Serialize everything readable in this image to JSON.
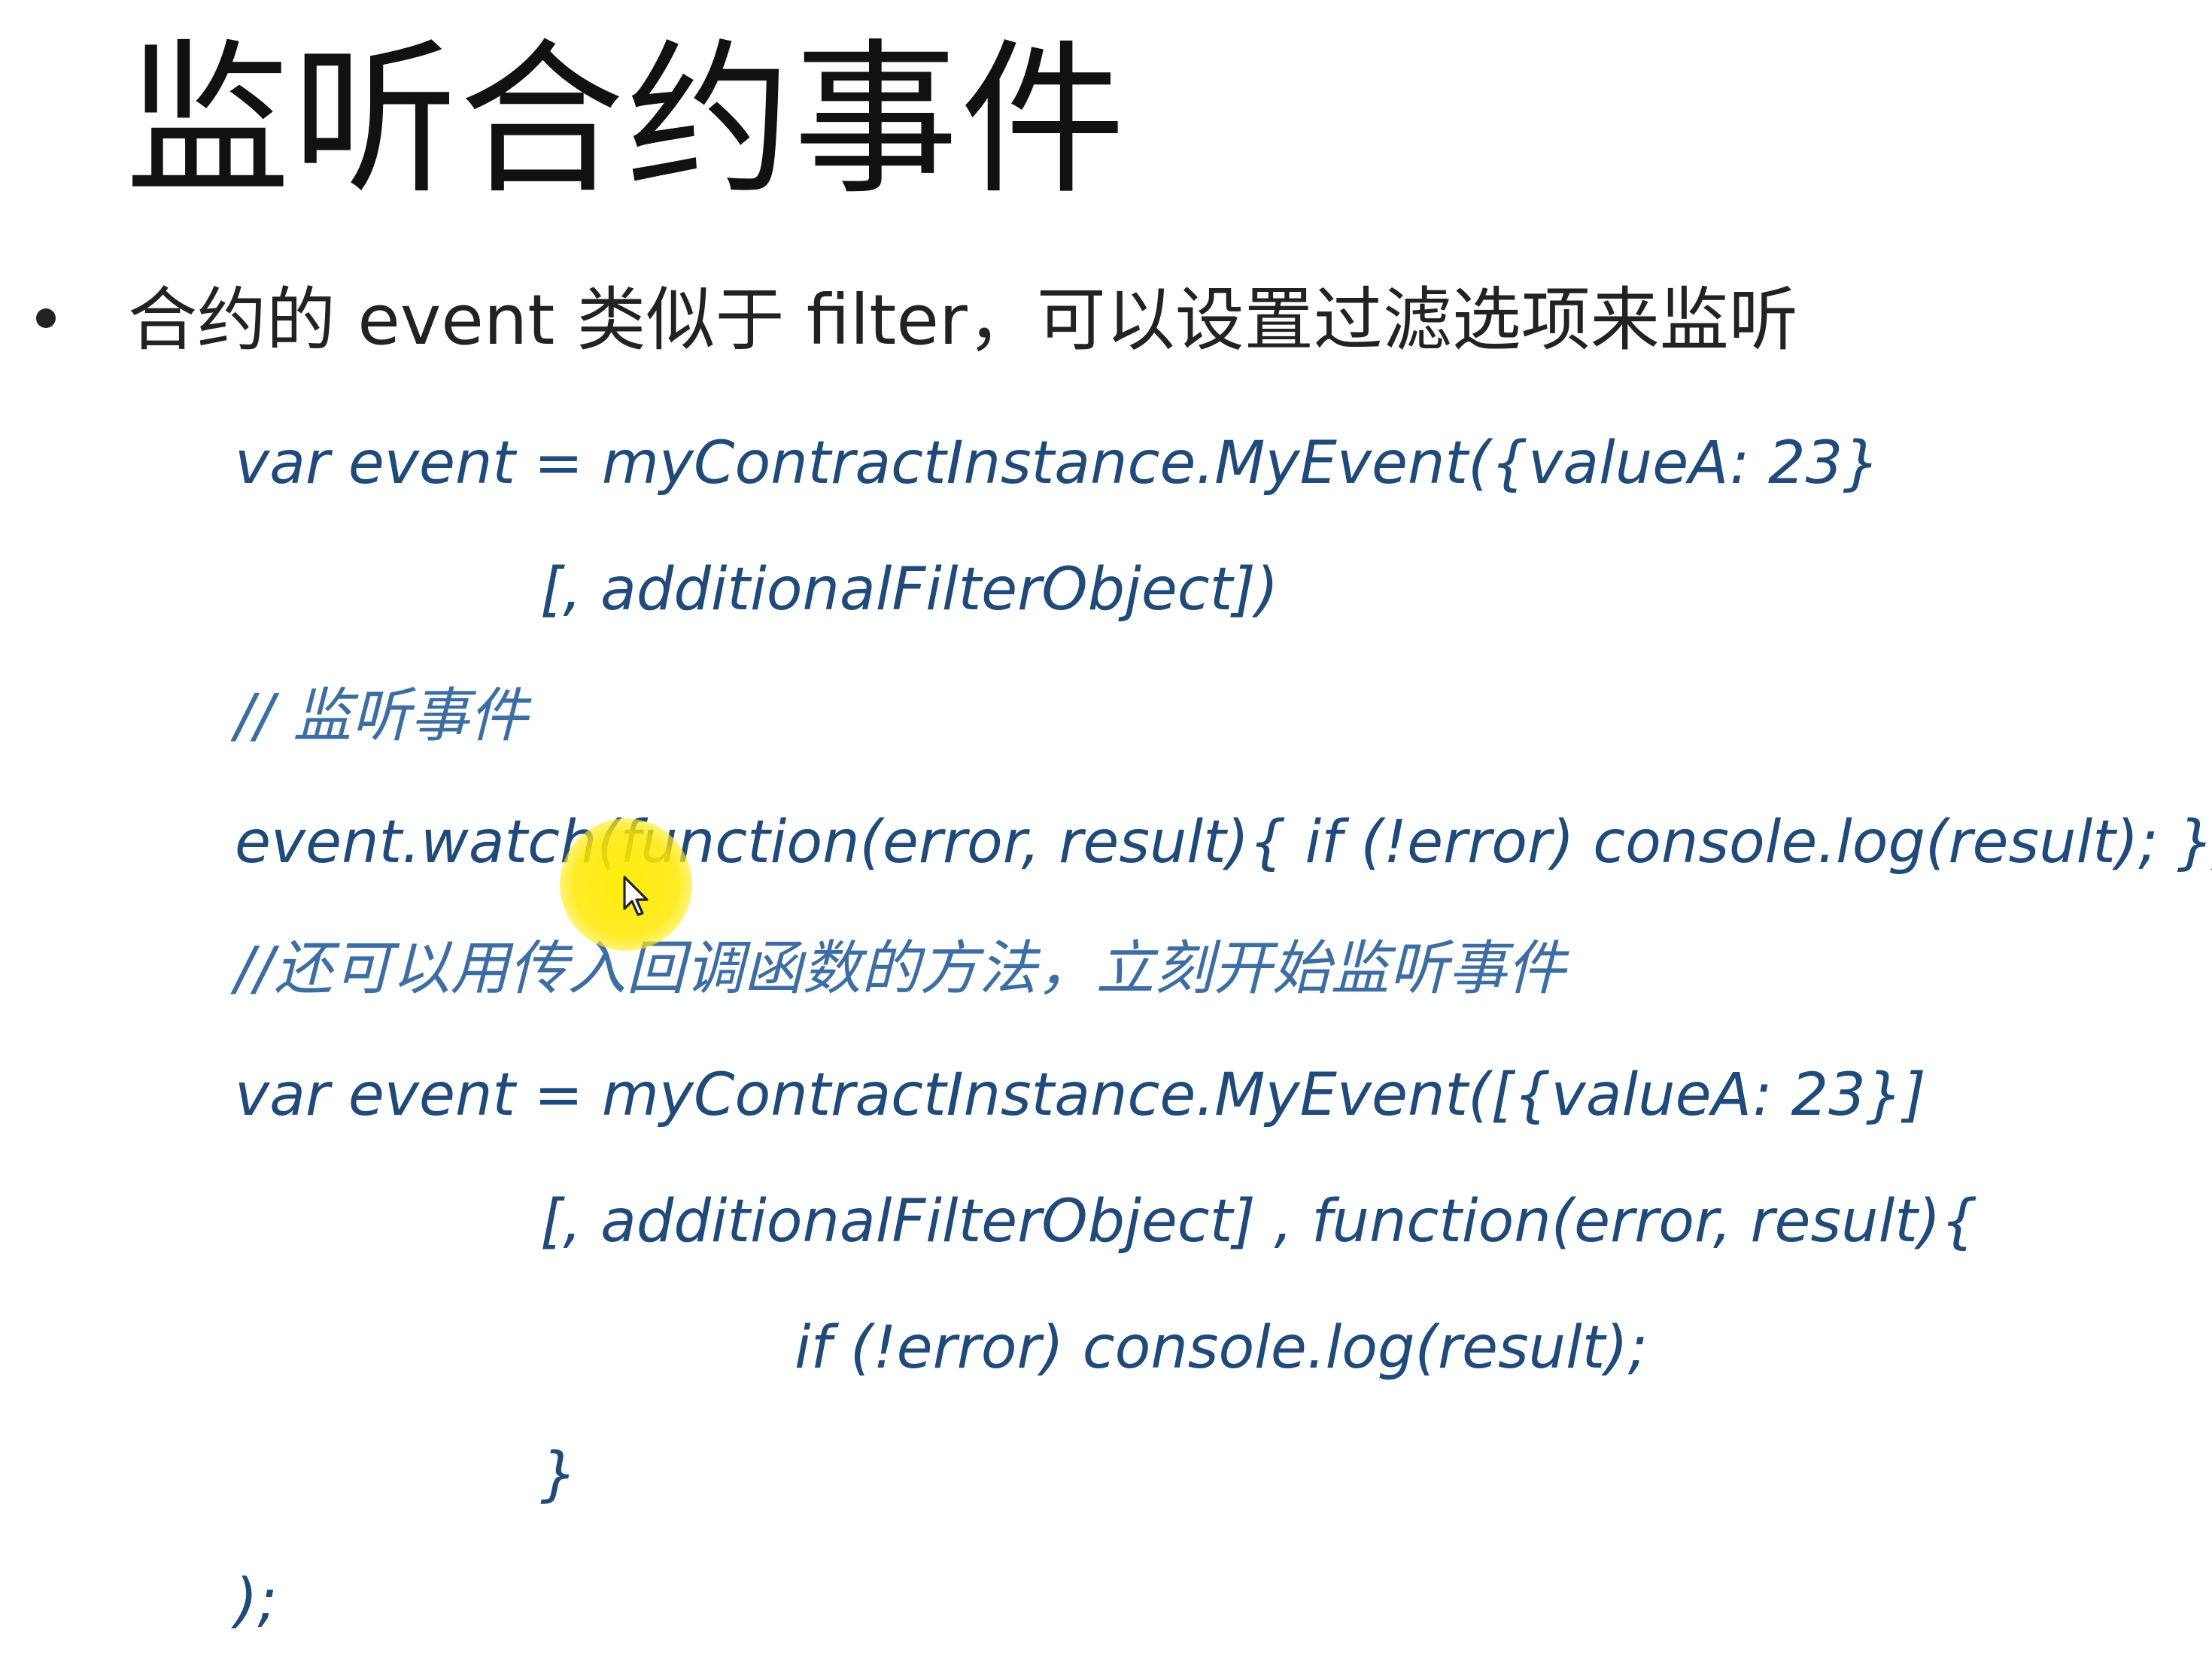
{
  "slide": {
    "title": "监听合约事件",
    "bullet": "合约的 event 类似于 filter，可以设置过滤选项来监听",
    "code_lines": [
      "var event = myContractInstance.MyEvent({valueA: 23}",
      "[, additionalFilterObject])",
      "// 监听事件",
      "event.watch(function(error, result){ if (!error) console.log(result); });",
      "//还可以用传入回调函数的方法，立刻开始监听事件",
      "var event = myContractInstance.MyEvent([{valueA: 23}]",
      "[, additionalFilterObject] , function(error, result){",
      "if (!error) console.log(result);",
      "}",
      ");"
    ]
  },
  "cursor": {
    "icon": "mouse-pointer-icon",
    "highlight_color": "#FFE800"
  },
  "colors": {
    "code": "#1F4A7A",
    "comment": "#3D6EA3",
    "title": "#111111"
  }
}
